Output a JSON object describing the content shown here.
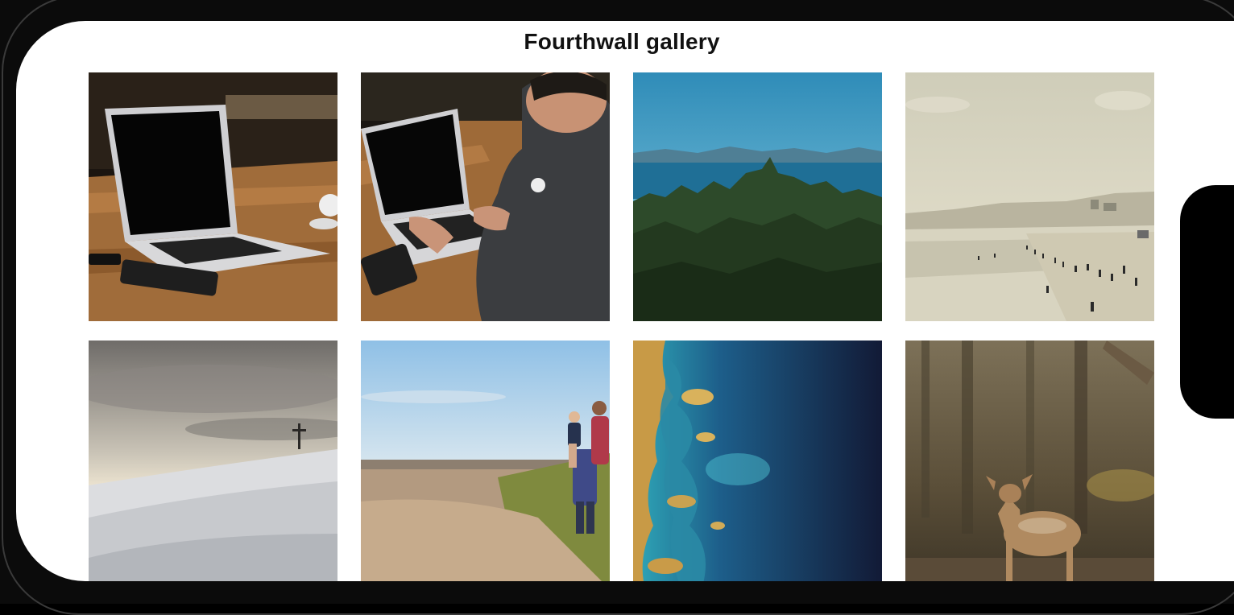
{
  "app": {
    "title": "Fourthwall gallery"
  },
  "gallery": {
    "photos": [
      {
        "subject": "laptop on wooden table"
      },
      {
        "subject": "person typing on laptop"
      },
      {
        "subject": "forest and sea landscape"
      },
      {
        "subject": "people on hazy beach"
      },
      {
        "subject": "snowy hill with cross"
      },
      {
        "subject": "father carrying child on beach path"
      },
      {
        "subject": "aerial view of ocean and coastline"
      },
      {
        "subject": "young deer in forest"
      }
    ]
  },
  "colors": {
    "background": "#ffffff",
    "bezel": "#0b0b0b",
    "title": "#111111"
  }
}
